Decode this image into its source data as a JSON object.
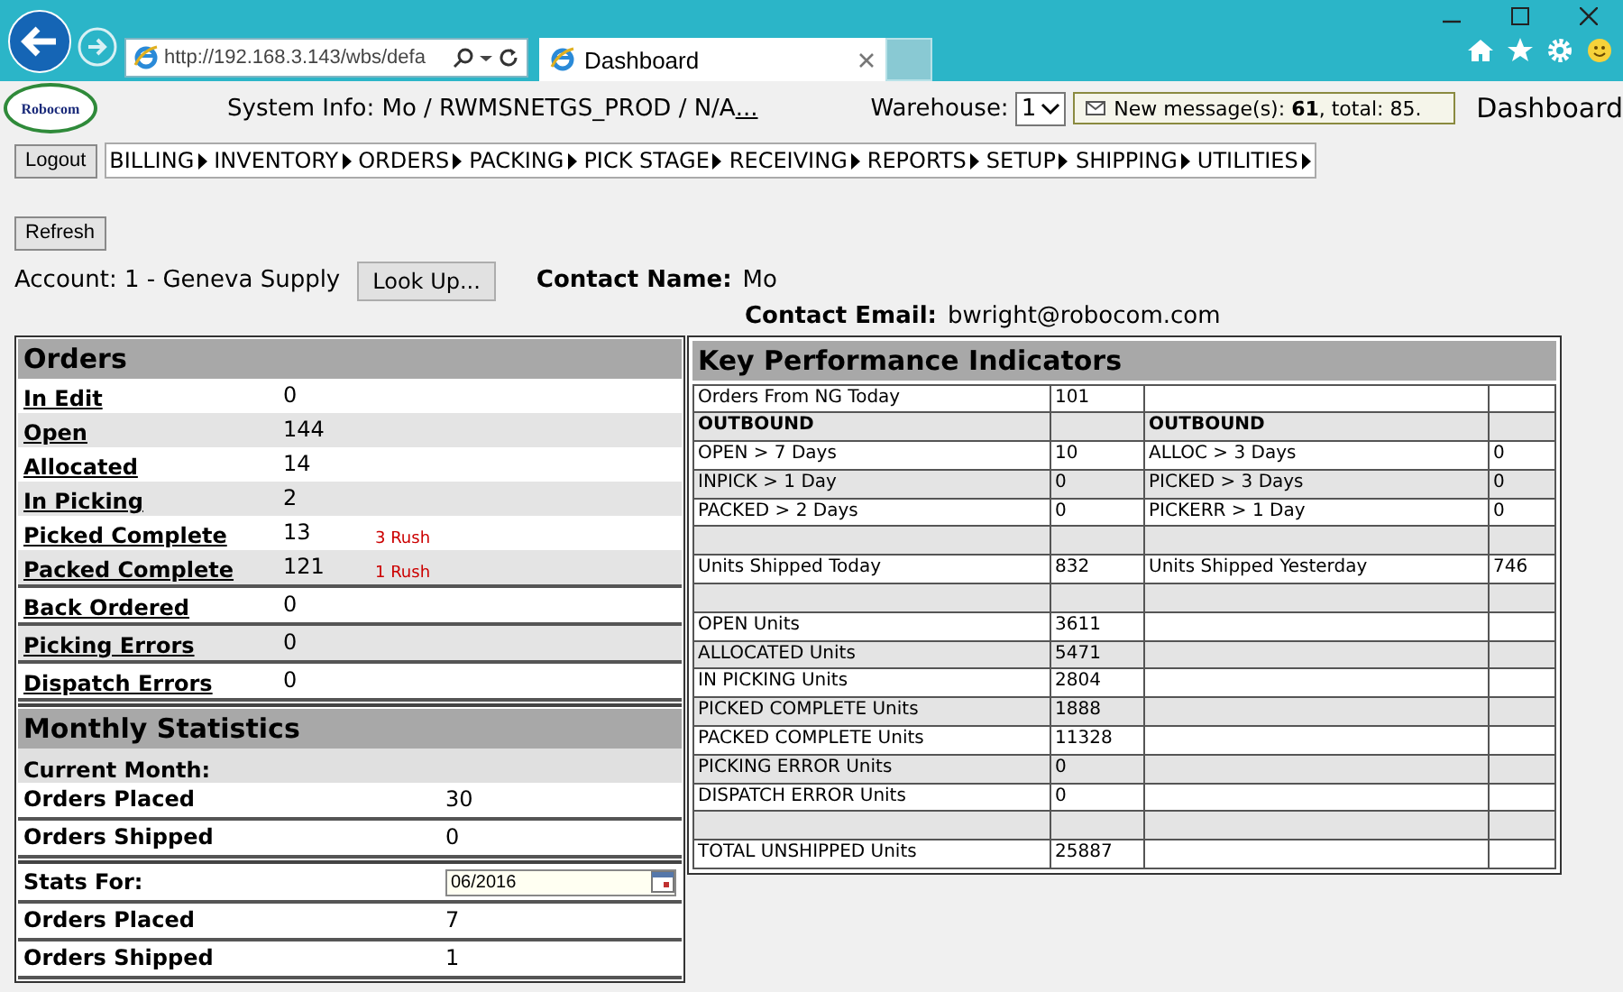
{
  "browser": {
    "address": "http://192.168.3.143/wbs/defa",
    "tabs": [
      {
        "label": "Dashboard",
        "selected": true
      }
    ]
  },
  "header": {
    "logo": "Robocom",
    "system_info": "System Info: Mo / RWMSNETGS_PROD / N/A",
    "system_info_more": "...",
    "warehouse_label": "Warehouse:",
    "warehouse_value": "1",
    "message": "New message(s): **61**, total: 85.",
    "page_title": "Dashboard"
  },
  "logout": "Logout",
  "menu": [
    "BILLING",
    "INVENTORY",
    "ORDERS",
    "PACKING",
    "PICK STAGE",
    "RECEIVING",
    "REPORTS",
    "SETUP",
    "SHIPPING",
    "UTILITIES"
  ],
  "refresh": "Refresh",
  "account": {
    "text": "Account: 1 - Geneva Supply",
    "lookup": "Look Up...",
    "contact_name_label": "Contact Name:",
    "contact_name": "Mo",
    "contact_email_label": "Contact Email:",
    "contact_email": "bwright@robocom.com"
  },
  "orders": {
    "title": "Orders",
    "rows": [
      {
        "label": "In Edit",
        "value": "0"
      },
      {
        "label": "Open",
        "value": "144"
      },
      {
        "label": "Allocated",
        "value": "14"
      },
      {
        "label": "In Picking",
        "value": "2"
      },
      {
        "label": "Picked Complete",
        "value": "13",
        "rush": "3 Rush"
      },
      {
        "label": "Packed Complete",
        "value": "121",
        "rush": "1 Rush"
      },
      {
        "label": "Back Ordered",
        "value": "0"
      },
      {
        "label": "Picking Errors",
        "value": "0"
      },
      {
        "label": "Dispatch Errors",
        "value": "0"
      }
    ]
  },
  "monthly": {
    "title": "Monthly Statistics",
    "current_label": "Current Month:",
    "current_rows": [
      {
        "label": "Orders Placed",
        "value": "30"
      },
      {
        "label": "Orders Shipped",
        "value": "0"
      }
    ],
    "stats_for_label": "Stats For:",
    "stats_for_value": "06/2016",
    "stats_rows": [
      {
        "label": "Orders Placed",
        "value": "7"
      },
      {
        "label": "Orders Shipped",
        "value": "1"
      }
    ]
  },
  "kpi": {
    "title": "Key Performance Indicators",
    "rows": [
      {
        "kind": "plain",
        "label": "Orders From NG Today",
        "value": "101"
      },
      {
        "kind": "heading",
        "label": "OUTBOUND",
        "label_2": "OUTBOUND"
      },
      {
        "kind": "plain",
        "label": "OPEN > 7 Days",
        "value": "10",
        "label_2": "ALLOC > 3 Days",
        "value_2": "0"
      },
      {
        "kind": "plain",
        "label": "INPICK > 1 Day",
        "value": "0",
        "label_2": "PICKED > 3 Days",
        "value_2": "0"
      },
      {
        "kind": "plain",
        "label": "PACKED > 2 Days",
        "value": "0",
        "label_2": "PICKERR > 1 Day",
        "value_2": "0"
      },
      {
        "kind": "blank"
      },
      {
        "kind": "plain",
        "label": "Units Shipped Today",
        "value": "832",
        "label_2": "Units Shipped Yesterday",
        "value_2": "746"
      },
      {
        "kind": "blank"
      },
      {
        "kind": "plain",
        "label": "OPEN Units",
        "value": "3611"
      },
      {
        "kind": "plain",
        "label": "ALLOCATED Units",
        "value": "5471"
      },
      {
        "kind": "plain",
        "label": "IN PICKING Units",
        "value": "2804"
      },
      {
        "kind": "plain",
        "label": "PICKED COMPLETE Units",
        "value": "1888"
      },
      {
        "kind": "plain",
        "label": "PACKED COMPLETE Units",
        "value": "11328"
      },
      {
        "kind": "plain",
        "label": "PICKING ERROR Units",
        "value": "0"
      },
      {
        "kind": "plain",
        "label": "DISPATCH ERROR Units",
        "value": "0"
      },
      {
        "kind": "blank"
      },
      {
        "kind": "plain",
        "label": "TOTAL UNSHIPPED Units",
        "value": "25887"
      }
    ]
  }
}
